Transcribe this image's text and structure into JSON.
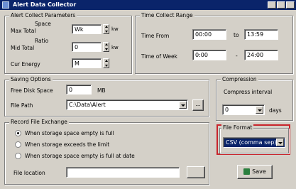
{
  "window": {
    "title": "Alert Data Collector"
  },
  "space_limit": {
    "title": "Alert Collect Parameters",
    "rows": [
      {
        "label": "Max Total",
        "sublabel": "Space",
        "value": "Wk",
        "unit": "kw"
      },
      {
        "label": "Mid Total",
        "sublabel": "Ratio",
        "value": "0",
        "unit": "kw"
      },
      {
        "label": "Cur Energy",
        "sublabel": "",
        "value": "M",
        "unit": ""
      }
    ]
  },
  "time_range": {
    "title": "Time Collect Range",
    "rows": [
      {
        "label": "Time From",
        "start": "00:00",
        "sep": "to",
        "end": "13:59"
      },
      {
        "label": "Time of Week",
        "start": "0:00",
        "sep": "-",
        "end": "24:00"
      }
    ]
  },
  "saving_options": {
    "title": "Saving Options",
    "free_space_label": "Free Disk Space",
    "free_space_value": "0",
    "free_space_unit": "MB",
    "file_path_label": "File Path",
    "file_path_value": "C:\\Data\\Alert",
    "browse_label": "..."
  },
  "compression": {
    "title": "Compression",
    "interval_label": "Compress interval",
    "interval_value": "0",
    "interval_unit": "days"
  },
  "on_exchange": {
    "title": "Record File Exchange",
    "options": [
      {
        "label": "When storage space empty is full",
        "selected": true
      },
      {
        "label": "When storage exceeds the limit",
        "selected": false
      },
      {
        "label": "When storage space empty is full at date",
        "selected": false
      }
    ],
    "file_path_label": "File location",
    "file_path_value": "",
    "browse_label": ""
  },
  "file_format": {
    "title": "File Format",
    "value": "CSV (comma sep)"
  },
  "save_button": {
    "label": "Save",
    "icon": "save-icon"
  }
}
